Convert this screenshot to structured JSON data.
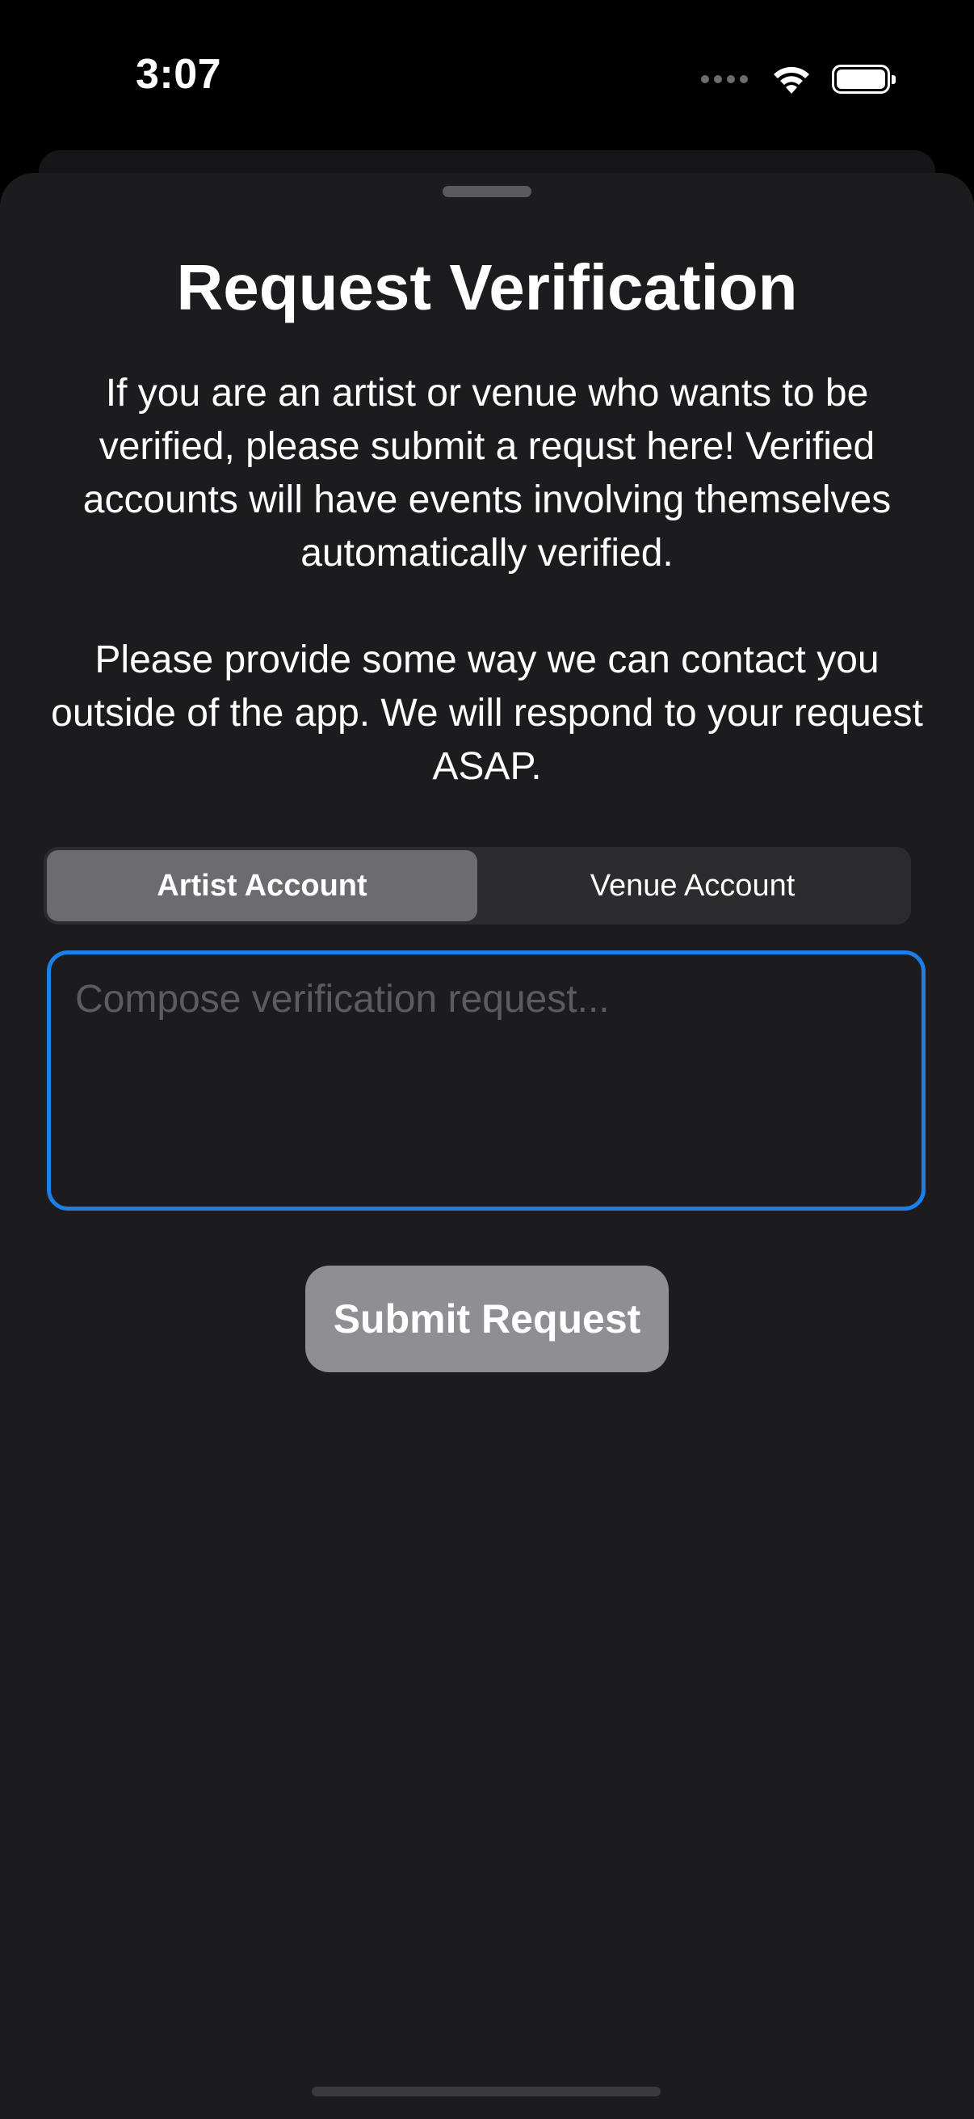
{
  "status_bar": {
    "time": "3:07",
    "icons": [
      "signal-dots-icon",
      "wifi-icon",
      "battery-icon"
    ]
  },
  "sheet": {
    "title": "Request Verification",
    "description_1": "If you are an artist or venue who wants to be verified, please submit a requst here! Verified accounts will have events involving themselves automatically verified.",
    "description_2": "Please provide some way we can contact you outside of the app. We will respond to your request ASAP.",
    "segmented_control": {
      "options": [
        "Artist Account",
        "Venue Account"
      ],
      "selected": "Artist Account"
    },
    "compose": {
      "value": "",
      "placeholder": "Compose verification request..."
    },
    "submit_label": "Submit Request"
  },
  "colors": {
    "background": "#000000",
    "sheet": "#1c1c1e",
    "accent_focus": "#1a7fe6",
    "segment_selected": "#6b6b70",
    "button_disabled": "#8e8e93"
  }
}
